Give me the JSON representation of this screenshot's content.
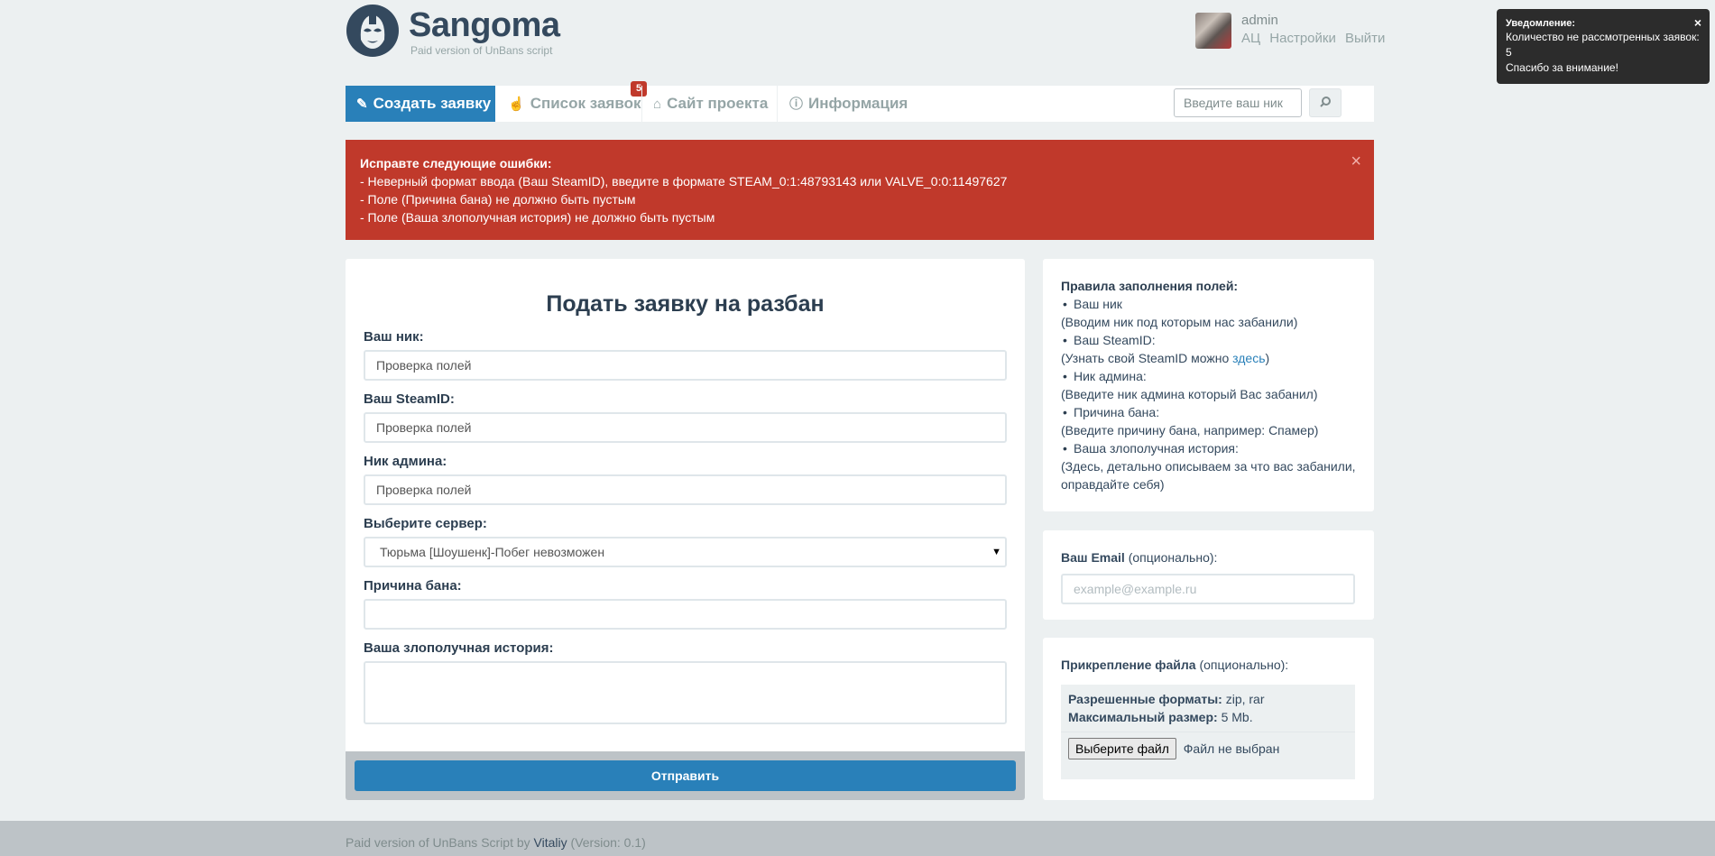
{
  "header": {
    "logo_title": "Sangoma",
    "logo_subtitle": "Paid version of UnBans script",
    "user_name": "admin",
    "user_links": [
      "АЦ",
      "Настройки",
      "Выйти"
    ]
  },
  "nav": {
    "items": [
      {
        "label": "Создать заявку",
        "icon": "pencil-icon"
      },
      {
        "label": "Список заявок",
        "icon": "hand-icon",
        "badge": "5"
      },
      {
        "label": "Сайт проекта",
        "icon": "home-icon"
      },
      {
        "label": "Информация",
        "icon": "info-icon"
      }
    ],
    "search_placeholder": "Введите ваш ник"
  },
  "alert": {
    "title": "Исправте следующие ошибки:",
    "lines": [
      "- Неверный формат ввода (Ваш SteamID), введите в формате STEAM_0:1:48793143 или VALVE_0:0:11497627",
      "- Поле (Причина бана) не должно быть пустым",
      "- Поле (Ваша злополучная история) не должно быть пустым"
    ],
    "close": "×"
  },
  "form": {
    "title": "Подать заявку на разбан",
    "nick_label": "Ваш ник:",
    "nick_value": "Проверка полей",
    "steam_label": "Ваш SteamID:",
    "steam_value": "Проверка полей",
    "admin_label": "Ник админа:",
    "admin_value": "Проверка полей",
    "server_label": "Выберите сервер:",
    "server_value": "Тюрьма [Шоушенк]-Побег невозможен",
    "reason_label": "Причина бана:",
    "reason_value": "",
    "story_label": "Ваша злополучная история:",
    "submit_label": "Отправить"
  },
  "rules": {
    "title": "Правила заполнения полей:",
    "items": [
      {
        "field": "Ваш ник",
        "hint": "(Вводим ник под которым нас забанили)"
      },
      {
        "field": "Ваш SteamID:",
        "hint_prefix": "(Узнать свой SteamID можно ",
        "link": "здесь",
        "hint_suffix": ")"
      },
      {
        "field": "Ник админа:",
        "hint": "(Введите ник админа который Вас забанил)"
      },
      {
        "field": "Причина бана:",
        "hint": "(Введите причину бана, например: Спамер)"
      },
      {
        "field": "Ваша злополучная история:",
        "hint": "(Здесь, детально описываем за что вас забанили, оправдайте себя)"
      }
    ]
  },
  "email": {
    "label_bold": "Ваш Email",
    "label_note": " (опционально):",
    "placeholder": "example@example.ru"
  },
  "attach": {
    "label_bold": "Прикрепление файла",
    "label_note": " (опционально):",
    "formats_label": "Разрешенные форматы:",
    "formats_value": " zip, rar",
    "size_label": "Максимальный размер:",
    "size_value": " 5 Mb.",
    "choose_button": "Выберите файл",
    "file_status": "Файл не выбран"
  },
  "footer": {
    "prefix": "Paid version of UnBans Script by ",
    "author": "Vitaliy",
    "suffix": " (Version: 0.1)"
  },
  "toast": {
    "title": "Уведомление:",
    "line1": "Количество не рассмотренных заявок: 5",
    "line2": "Спасибо за внимание!",
    "close": "×"
  },
  "colors": {
    "primary": "#2980b9",
    "danger": "#c0392b",
    "background": "#ecf0f1"
  }
}
